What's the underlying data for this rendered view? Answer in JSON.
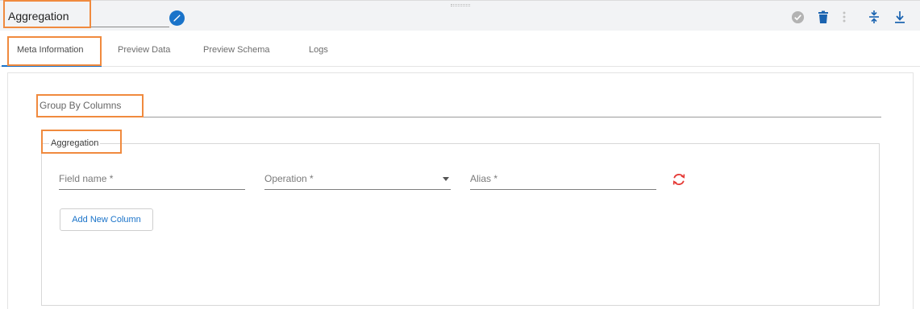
{
  "header": {
    "title": "Aggregation",
    "icons": [
      "pencil-icon",
      "check-circle-icon",
      "trash-icon",
      "more-vertical-icon",
      "collapse-icon",
      "download-icon"
    ]
  },
  "tabs": [
    {
      "label": "Meta Information",
      "active": true
    },
    {
      "label": "Preview Data",
      "active": false
    },
    {
      "label": "Preview Schema",
      "active": false
    },
    {
      "label": "Logs",
      "active": false
    }
  ],
  "form": {
    "group_by_label": "Group By Columns",
    "aggregation_legend": "Aggregation",
    "fields": {
      "field_name": "Field name *",
      "operation": "Operation *",
      "alias": "Alias *"
    },
    "add_column_label": "Add New Column"
  },
  "colors": {
    "accent": "#1a73c9",
    "highlight": "#f08a3e",
    "sync_icon": "#e53935"
  }
}
